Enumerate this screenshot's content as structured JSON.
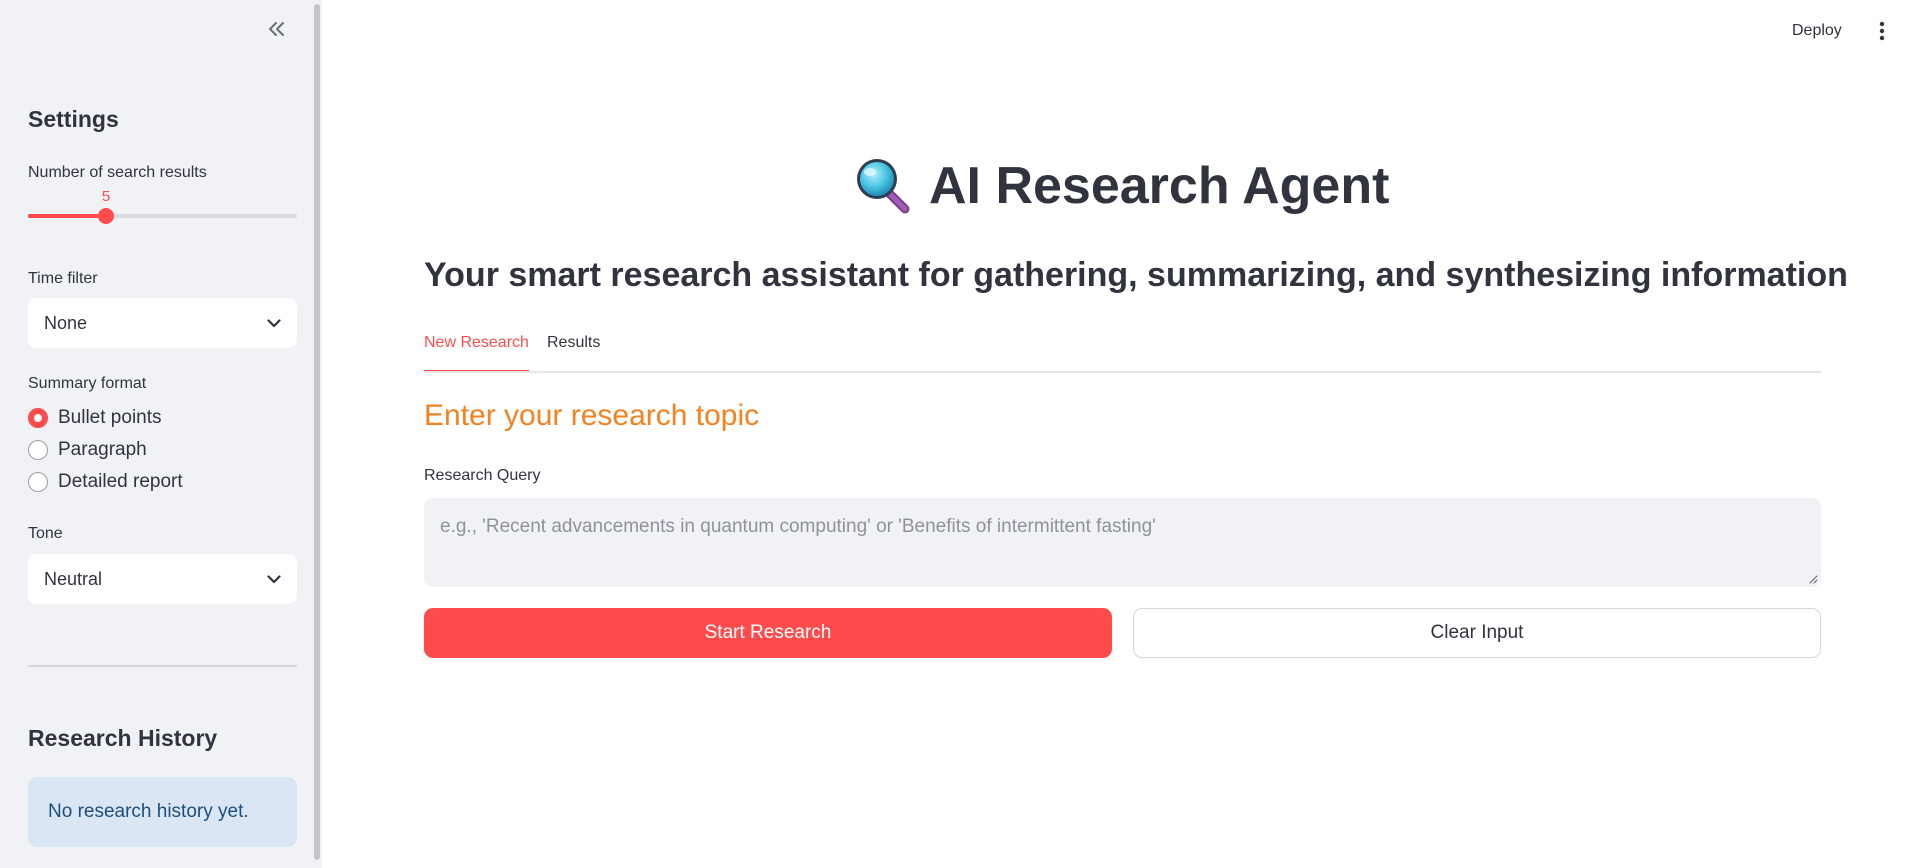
{
  "header": {
    "deploy_label": "Deploy",
    "menu_icon": "kebab-menu-icon"
  },
  "sidebar": {
    "collapse_icon": "double-chevron-left-icon",
    "settings_title": "Settings",
    "num_results": {
      "label": "Number of search results",
      "value": "5",
      "fraction": 0.29
    },
    "time_filter": {
      "label": "Time filter",
      "selected": "None"
    },
    "summary_format": {
      "label": "Summary format",
      "options": [
        "Bullet points",
        "Paragraph",
        "Detailed report"
      ],
      "selected_index": 0
    },
    "tone": {
      "label": "Tone",
      "selected": "Neutral"
    },
    "history": {
      "title": "Research History",
      "empty_message": "No research history yet."
    }
  },
  "main": {
    "title_icon": "magnifying-glass-icon",
    "title": "AI Research Agent",
    "subtitle": "Your smart research assistant for gathering, summarizing, and synthesizing information",
    "tabs": [
      {
        "label": "New Research",
        "active": true
      },
      {
        "label": "Results",
        "active": false
      }
    ],
    "section_heading": "Enter your research topic",
    "query_label": "Research Query",
    "query_placeholder": "e.g., 'Recent advancements in quantum computing' or 'Benefits of intermittent fasting'",
    "query_value": "",
    "start_button": "Start Research",
    "clear_button": "Clear Input"
  },
  "colors": {
    "accent": "#ff4b4b",
    "heading_orange": "#f5811f",
    "sidebar_bg": "#f0f2f6",
    "info_bg": "#dbe6f4"
  }
}
